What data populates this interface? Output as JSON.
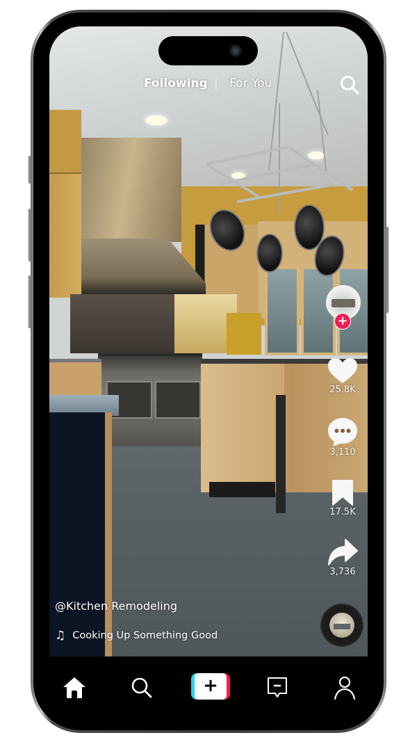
{
  "top_nav": {
    "following_label": "Following",
    "separator": "|",
    "for_you_label": "For You",
    "search_icon": "search-icon"
  },
  "video": {
    "scene": "modern kitchen with stainless range hood, hanging pot rack and wood island",
    "username": "@Kitchen Remodeling",
    "sound_icon": "music-note-icon",
    "sound_title": "Cooking Up Something Good"
  },
  "side_actions": {
    "follow_label": "+",
    "likes": {
      "icon": "heart-icon",
      "count": "25.8K"
    },
    "comments": {
      "icon": "comment-icon",
      "count": "3,110"
    },
    "saves": {
      "icon": "bookmark-icon",
      "count": "17.5K"
    },
    "shares": {
      "icon": "share-icon",
      "count": "3,736"
    }
  },
  "bottom_nav": {
    "items": [
      {
        "name": "home",
        "icon": "home-icon",
        "active": true
      },
      {
        "name": "discover",
        "icon": "search-icon"
      },
      {
        "name": "create",
        "icon": "plus-icon",
        "label": "+"
      },
      {
        "name": "inbox",
        "icon": "inbox-icon"
      },
      {
        "name": "profile",
        "icon": "profile-icon"
      }
    ]
  },
  "colors": {
    "accent_red": "#ee1d52",
    "accent_cyan": "#25d7e8",
    "text": "#ffffff",
    "bar_bg": "#000000"
  }
}
